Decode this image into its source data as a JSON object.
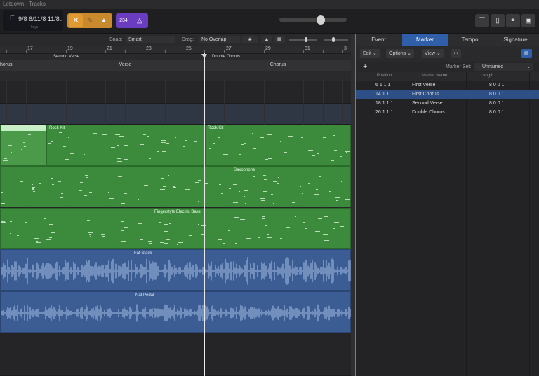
{
  "window": {
    "title": "Letdown - Tracks"
  },
  "lcd": {
    "key": "F",
    "signature": "9/8 6/11/8 11/8",
    "sub": "keys"
  },
  "control_icons": {
    "left_tools": [
      "cycle-icon",
      "pencil-icon",
      "metronome-icon"
    ],
    "purple": [
      "count-in-icon",
      "tuner-icon"
    ],
    "purple_label": "234",
    "right": [
      "list-editor-icon",
      "notepad-icon",
      "loop-browser-icon",
      "library-icon"
    ]
  },
  "tracks_toolbar": {
    "snap_label": "Snap:",
    "snap_value": "Smart",
    "drag_label": "Drag:",
    "drag_value": "No Overlap"
  },
  "ruler": {
    "bars": [
      "17",
      "19",
      "21",
      "23",
      "25",
      "27",
      "29",
      "31",
      "3"
    ]
  },
  "markers": [
    {
      "label": "Second Verse"
    },
    {
      "label": "Double Chorus"
    }
  ],
  "arrangement": [
    {
      "label": "horus"
    },
    {
      "label": "Verse"
    },
    {
      "label": "Chorus"
    }
  ],
  "regions": {
    "rock_kit_1": "Rock Kit",
    "rock_kit_2": "Rock Kit",
    "saxophone": "Saxophone",
    "bass": "Fingerstyle Electric Bass",
    "fat_stack": "Fat Stack",
    "nat_pedal": "Nat Pedal"
  },
  "list_editor": {
    "tabs": [
      {
        "label": "Event",
        "active": false
      },
      {
        "label": "Marker",
        "active": true
      },
      {
        "label": "Tempo",
        "active": false
      },
      {
        "label": "Signature",
        "active": false
      }
    ],
    "menus": {
      "edit": "Edit",
      "options": "Options",
      "view": "View"
    },
    "marker_set_label": "Marker Set:",
    "marker_set_value": "Unnamed",
    "columns": {
      "position": "Position",
      "name": "Marker Name",
      "length": "Length"
    },
    "rows": [
      {
        "position": "6 1 1   1",
        "name": "First Verse",
        "length": "8 0 0   1",
        "selected": false
      },
      {
        "position": "14 1 1   1",
        "name": "First Chorus",
        "length": "8 0 0   1",
        "selected": true
      },
      {
        "position": "18 1 1   1",
        "name": "Second Verse",
        "length": "8 0 0   1",
        "selected": false
      },
      {
        "position": "26 1 1   1",
        "name": "Double Chorus",
        "length": "8 0 0   1",
        "selected": false
      }
    ]
  }
}
